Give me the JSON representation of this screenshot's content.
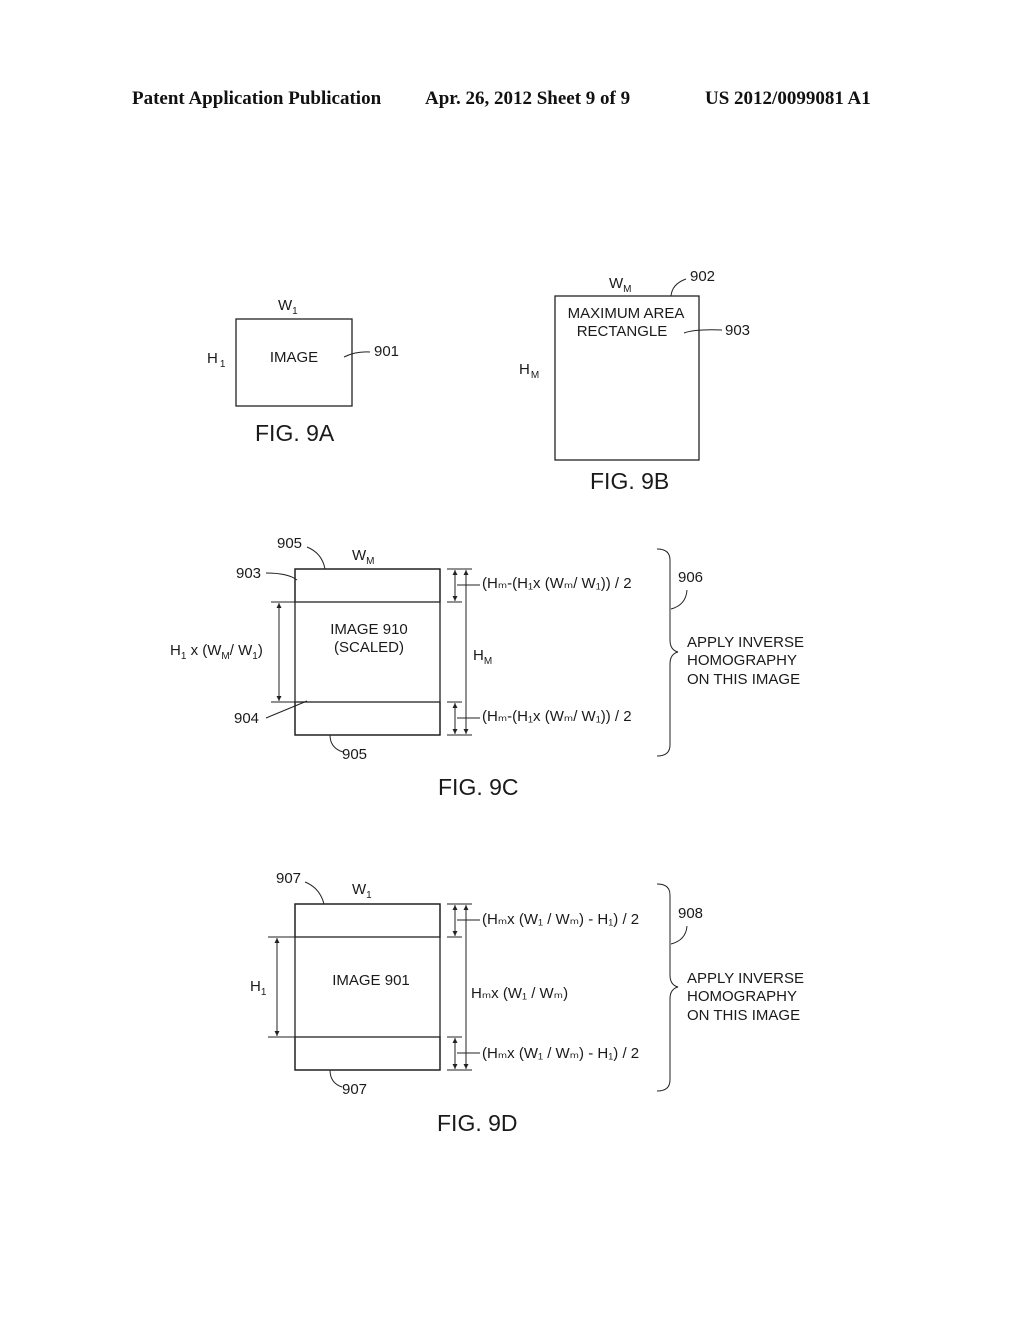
{
  "header": {
    "publication": "Patent Application Publication",
    "date_sheet": "Apr. 26, 2012  Sheet 9 of 9",
    "patent_number": "US 2012/0099081 A1"
  },
  "fig9a": {
    "caption": "FIG. 9A",
    "box_label": "IMAGE",
    "width_label": "W",
    "width_sub": "1",
    "height_label": "H",
    "height_sub": "1",
    "ref": "901"
  },
  "fig9b": {
    "caption": "FIG. 9B",
    "box_label_line1": "MAXIMUM AREA",
    "box_label_line2": "RECTANGLE",
    "width_label": "W",
    "width_sub": "M",
    "height_label": "H",
    "height_sub": "M",
    "ref_box": "902",
    "ref_label": "903"
  },
  "fig9c": {
    "caption": "FIG. 9C",
    "image_label_line1": "IMAGE 910",
    "image_label_line2": "(SCALED)",
    "width_label": "W",
    "width_sub": "M",
    "left_dim": "H₁ x (Wₘ/ W₁)",
    "right_dim": "H",
    "right_dim_sub": "M",
    "top_gap_formula": "(Hₘ-(H₁x (Wₘ/ W₁)) / 2",
    "bottom_gap_formula": "(Hₘ-(H₁x (Wₘ/ W₁)) / 2",
    "ref_hatch_top": "905",
    "ref_hatch_bottom": "905",
    "ref_rect": "903",
    "ref_image": "904",
    "ref_brace": "906",
    "brace_text": [
      "APPLY INVERSE",
      "HOMOGRAPHY",
      "ON THIS IMAGE"
    ]
  },
  "fig9d": {
    "caption": "FIG. 9D",
    "image_label": "IMAGE 901",
    "width_label": "W",
    "width_sub": "1",
    "left_dim": "H",
    "left_dim_sub": "1",
    "right_dim": "Hₘx (W₁ / Wₘ)",
    "top_gap_formula": "(Hₘx (W₁ / Wₘ) - H₁) / 2",
    "bottom_gap_formula": "(Hₘx (W₁ / Wₘ) - H₁) / 2",
    "ref_hatch_top": "907",
    "ref_hatch_bottom": "907",
    "ref_brace": "908",
    "brace_text": [
      "APPLY INVERSE",
      "HOMOGRAPHY",
      "ON THIS IMAGE"
    ]
  }
}
